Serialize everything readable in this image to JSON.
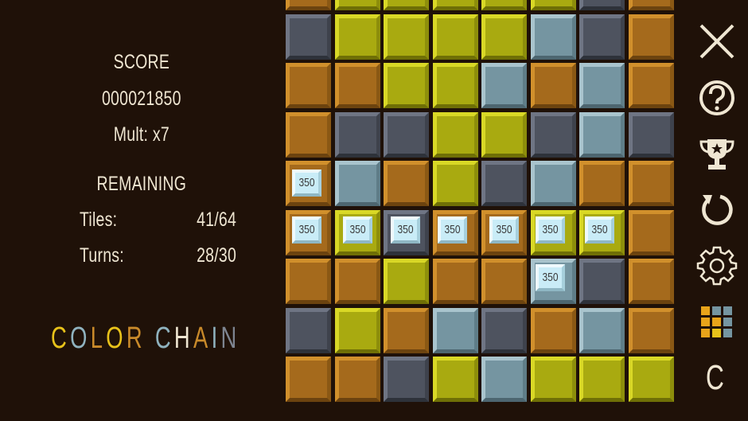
{
  "score": {
    "label": "SCORE",
    "value": "000021850",
    "mult": "Mult: x7"
  },
  "remaining": {
    "label": "REMAINING",
    "tiles_label": "Tiles:",
    "tiles_value": "41/64",
    "turns_label": "Turns:",
    "turns_value": "28/30"
  },
  "logo": {
    "letters": [
      {
        "ch": "C",
        "color": "#e8c21a"
      },
      {
        "ch": "O",
        "color": "#8fb2be"
      },
      {
        "ch": "L",
        "color": "#c98a2a"
      },
      {
        "ch": "O",
        "color": "#e8c21a"
      },
      {
        "ch": "R",
        "color": "#c98a2a"
      },
      {
        "ch": " ",
        "color": "#000000"
      },
      {
        "ch": "C",
        "color": "#8fb2be"
      },
      {
        "ch": "H",
        "color": "#efe6d2"
      },
      {
        "ch": "A",
        "color": "#c98a2a"
      },
      {
        "ch": "I",
        "color": "#8fb2be"
      },
      {
        "ch": "N",
        "color": "#7d8490"
      }
    ]
  },
  "colors": {
    "brown": "#a56a1c",
    "yellow": "#a9aa10",
    "blue": "#7595a1",
    "gray": "#4e535f",
    "background": "#1f1108"
  },
  "board": {
    "rows": [
      [
        "brown",
        "yellow",
        "yellow",
        "yellow",
        "yellow",
        "yellow",
        "gray",
        "brown"
      ],
      [
        "gray",
        "yellow",
        "yellow",
        "yellow",
        "yellow",
        "blue",
        "gray",
        "brown"
      ],
      [
        "brown",
        "brown",
        "yellow",
        "yellow",
        "blue",
        "brown",
        "blue",
        "brown"
      ],
      [
        "brown",
        "gray",
        "gray",
        "yellow",
        "yellow",
        "gray",
        "blue",
        "gray"
      ],
      [
        "brown",
        "blue",
        "brown",
        "yellow",
        "gray",
        "blue",
        "brown",
        "brown"
      ],
      [
        "brown",
        "yellow",
        "gray",
        "brown",
        "brown",
        "yellow",
        "yellow",
        "brown"
      ],
      [
        "brown",
        "brown",
        "yellow",
        "brown",
        "brown",
        "blue",
        "gray",
        "brown"
      ],
      [
        "gray",
        "yellow",
        "brown",
        "blue",
        "gray",
        "brown",
        "blue",
        "brown"
      ],
      [
        "brown",
        "brown",
        "gray",
        "yellow",
        "blue",
        "yellow",
        "yellow",
        "yellow"
      ]
    ],
    "points": [
      "350",
      "350",
      "350",
      "350",
      "350",
      "350",
      "350",
      "350",
      "350"
    ]
  },
  "side_buttons": [
    {
      "name": "close-icon",
      "label": "Close"
    },
    {
      "name": "help-icon",
      "label": "Help"
    },
    {
      "name": "trophy-icon",
      "label": "Trophies"
    },
    {
      "name": "restart-icon",
      "label": "Restart"
    },
    {
      "name": "settings-icon",
      "label": "Settings"
    },
    {
      "name": "level-grid-icon",
      "label": "Levels"
    }
  ],
  "side_letter": "C"
}
